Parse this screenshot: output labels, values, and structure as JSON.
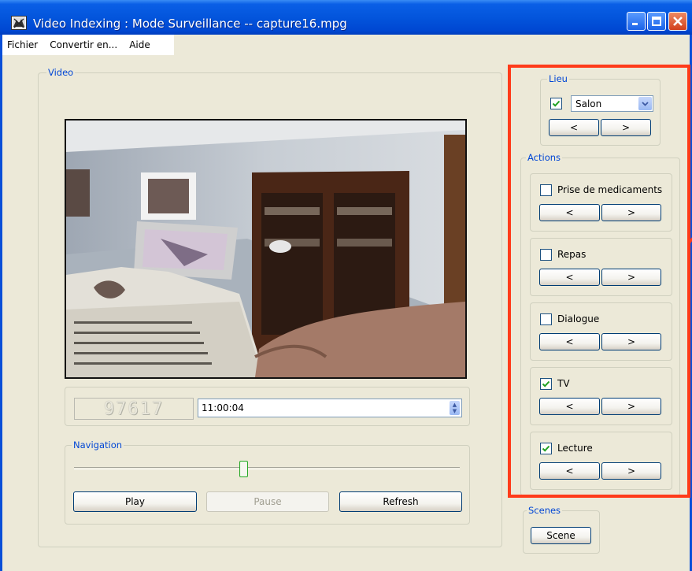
{
  "window": {
    "title": "Video Indexing : Mode Surveillance -- capture16.mpg",
    "min_icon": "minimize-icon",
    "max_icon": "maximize-icon",
    "close_icon": "close-icon",
    "titlebar_color": "#0355dc"
  },
  "menu": {
    "items": [
      "Fichier",
      "Convertir en...",
      "Aide"
    ]
  },
  "video": {
    "group_label": "Video",
    "frame_counter": "97617",
    "time_value": "11:00:04"
  },
  "navigation": {
    "group_label": "Navigation",
    "slider_position": 0.44,
    "play_label": "Play",
    "pause_label": "Pause",
    "refresh_label": "Refresh"
  },
  "lieu": {
    "group_label": "Lieu",
    "checked": true,
    "selected": "Salon",
    "prev_label": "<",
    "next_label": ">"
  },
  "actions": {
    "group_label": "Actions",
    "items": [
      {
        "label": "Prise de medicaments",
        "checked": false,
        "prev_label": "<",
        "next_label": ">"
      },
      {
        "label": "Repas",
        "checked": false,
        "prev_label": "<",
        "next_label": ">"
      },
      {
        "label": "Dialogue",
        "checked": false,
        "prev_label": "<",
        "next_label": ">"
      },
      {
        "label": "TV",
        "checked": true,
        "prev_label": "<",
        "next_label": ">"
      },
      {
        "label": "Lecture",
        "checked": true,
        "prev_label": "<",
        "next_label": ">"
      }
    ]
  },
  "scenes": {
    "group_label": "Scenes",
    "button_label": "Scene"
  },
  "highlight_color": "#ff3b1a"
}
